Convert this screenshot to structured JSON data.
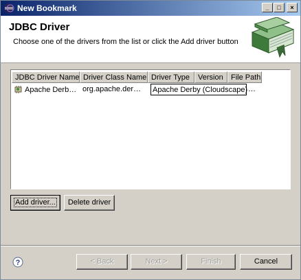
{
  "window": {
    "title": "New Bookmark",
    "controls": [
      "minimize",
      "maximize",
      "close"
    ]
  },
  "header": {
    "title": "JDBC Driver",
    "description": "Choose one of the drivers from the list or click the Add driver button"
  },
  "table": {
    "columns": [
      "JDBC Driver Name",
      "Driver Class Name",
      "Driver Type",
      "Version",
      "File Path"
    ],
    "rows": [
      {
        "name": "Apache Derb…",
        "class_name": "org.apache.der…",
        "driver_type": "Apache Derby (Cloudscape)",
        "version": "…",
        "file_path": ""
      }
    ]
  },
  "actions": {
    "add_driver": "Add driver...",
    "delete_driver": "Delete driver"
  },
  "footer": {
    "back": "< Back",
    "next": "Next >",
    "finish": "Finish",
    "cancel": "Cancel"
  }
}
